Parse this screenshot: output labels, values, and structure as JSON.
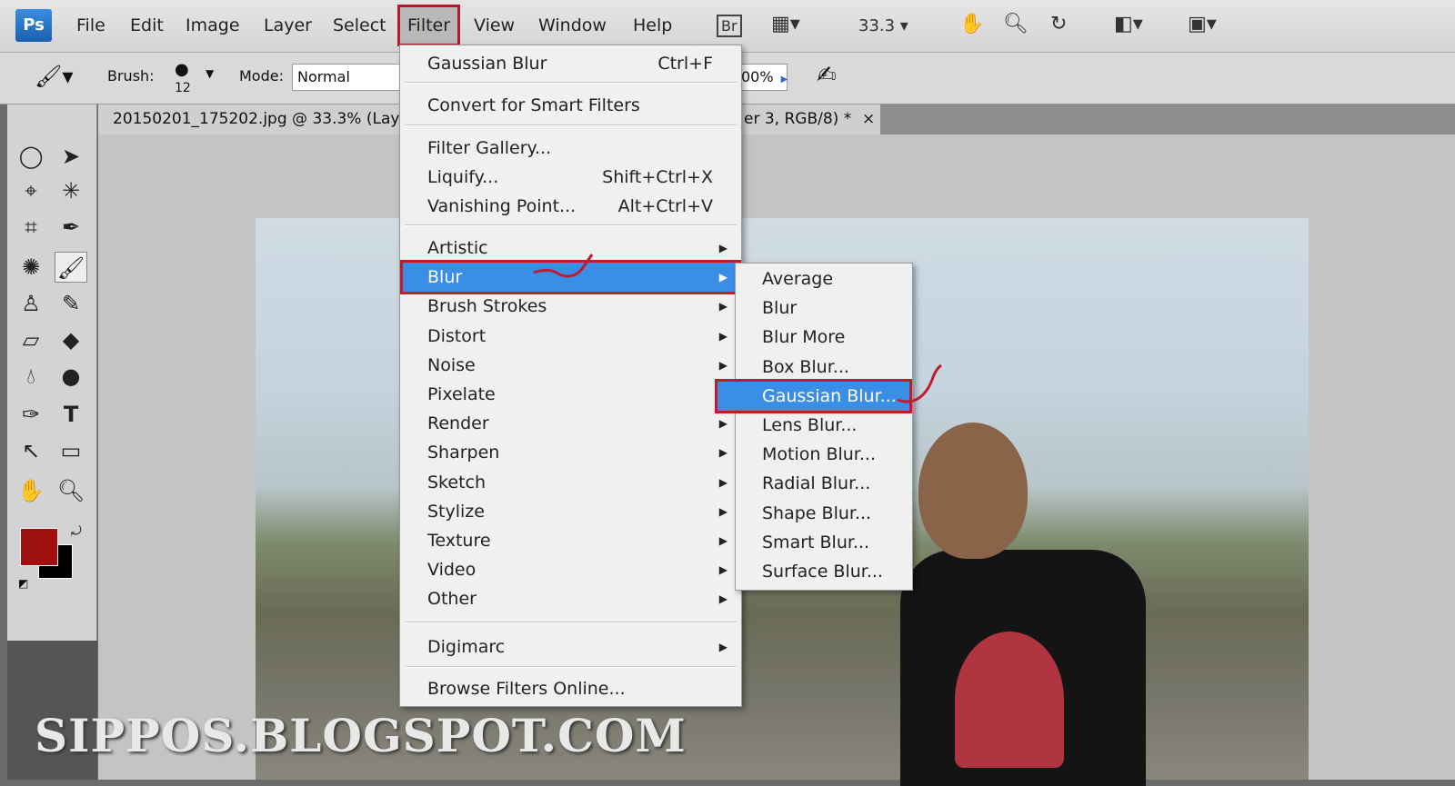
{
  "app": {
    "logo": "Ps"
  },
  "menubar": {
    "items": [
      "File",
      "Edit",
      "Image",
      "Layer",
      "Select",
      "Filter",
      "View",
      "Window",
      "Help"
    ],
    "active": "Filter",
    "bridge": "Br",
    "zoom": "33.3"
  },
  "options": {
    "brush_label": "Brush:",
    "brush_size": "12",
    "mode_label": "Mode:",
    "mode_value": "Normal",
    "opacity_value": "00%"
  },
  "document_tab": {
    "title_left": "20150201_175202.jpg @ 33.3% (Lay",
    "title_right": "er 3, RGB/8) *",
    "close": "×"
  },
  "filter_menu": {
    "last_filter": {
      "label": "Gaussian Blur",
      "shortcut": "Ctrl+F"
    },
    "smart": "Convert for Smart Filters",
    "gallery": {
      "label": "Filter Gallery..."
    },
    "liquify": {
      "label": "Liquify...",
      "shortcut": "Shift+Ctrl+X"
    },
    "vanishing": {
      "label": "Vanishing Point...",
      "shortcut": "Alt+Ctrl+V"
    },
    "groups": [
      "Artistic",
      "Blur",
      "Brush Strokes",
      "Distort",
      "Noise",
      "Pixelate",
      "Render",
      "Sharpen",
      "Sketch",
      "Stylize",
      "Texture",
      "Video",
      "Other"
    ],
    "highlighted": "Blur",
    "digimarc": "Digimarc",
    "browse": "Browse Filters Online..."
  },
  "blur_menu": {
    "items": [
      "Average",
      "Blur",
      "Blur More",
      "Box Blur...",
      "Gaussian Blur...",
      "Lens Blur...",
      "Motion Blur...",
      "Radial Blur...",
      "Shape Blur...",
      "Smart Blur...",
      "Surface Blur..."
    ],
    "highlighted": "Gaussian Blur..."
  },
  "colors": {
    "foreground": "#a01010",
    "background": "#000000",
    "highlight": "#3a8ee6",
    "annotation": "#c01c2c"
  },
  "watermark": "SIPPOS.BLOGSPOT.COM"
}
